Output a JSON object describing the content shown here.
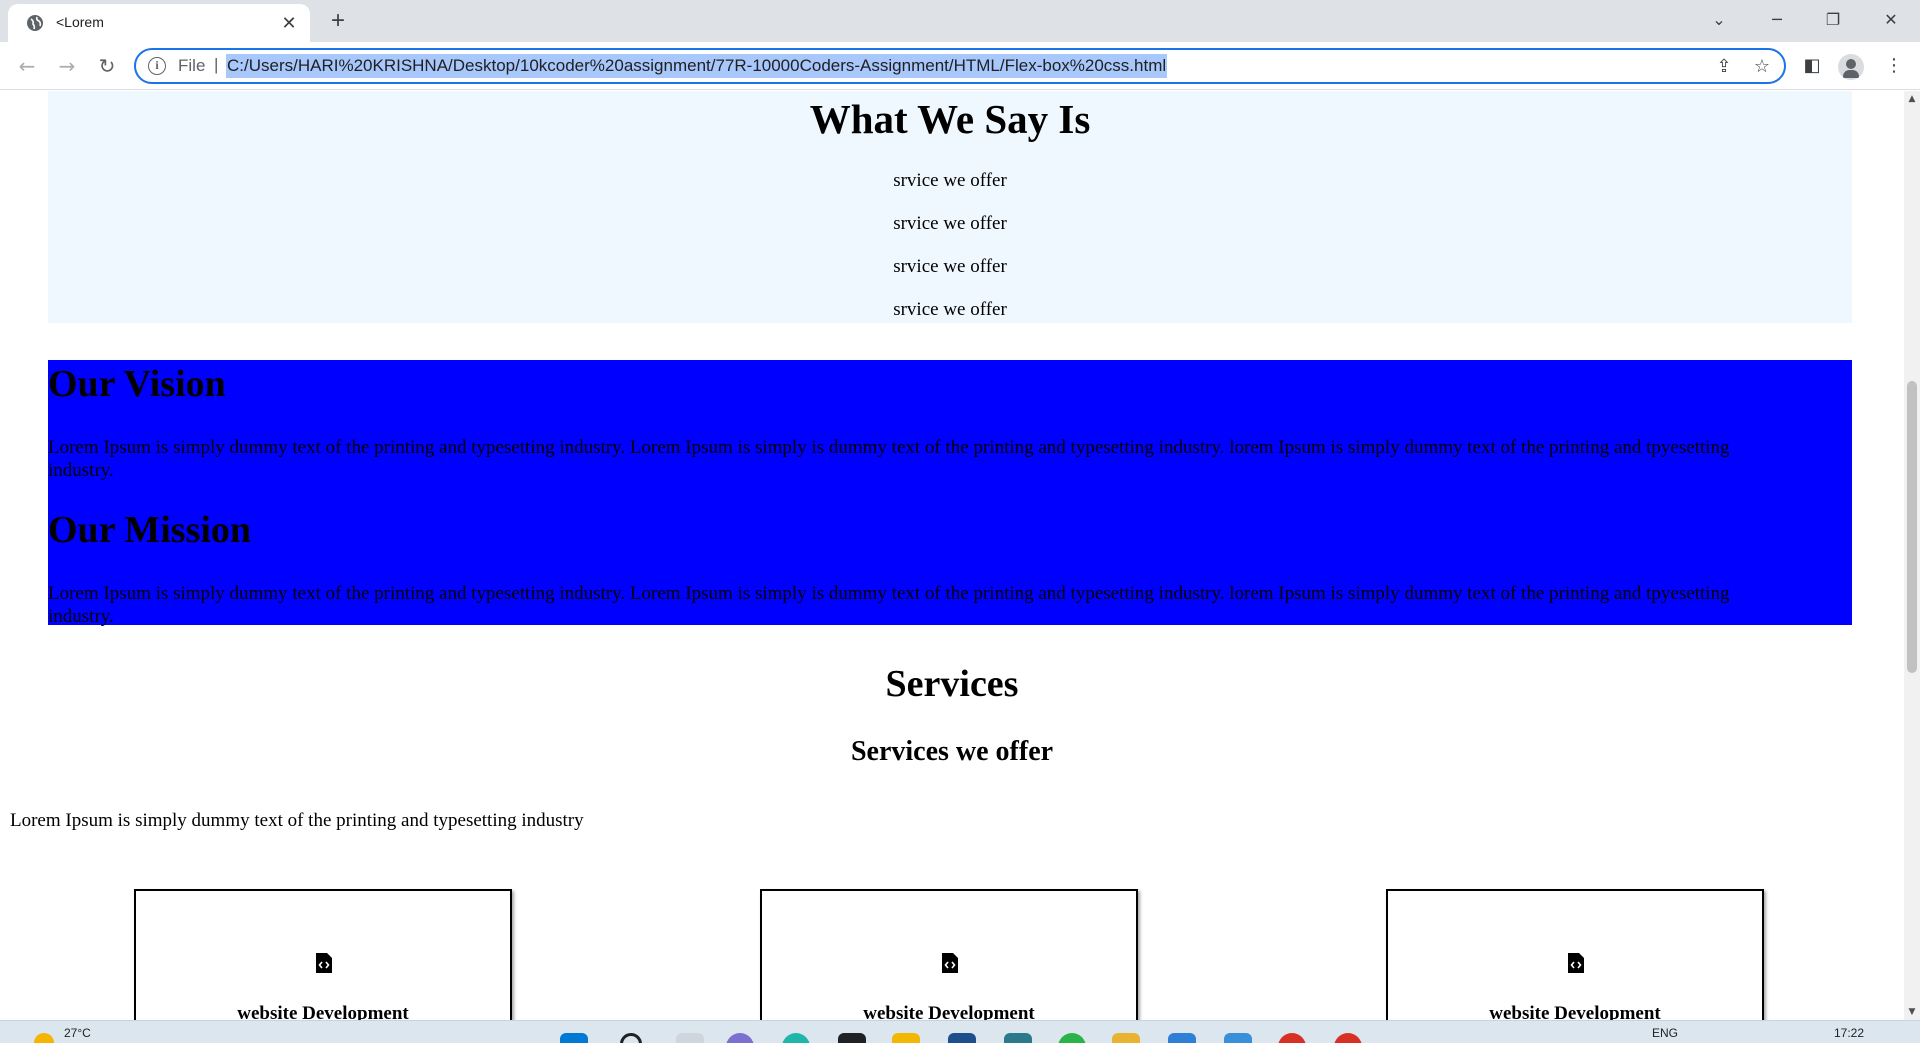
{
  "browser": {
    "tab_title": "<Lorem",
    "new_tab_symbol": "+",
    "url_scheme": "File",
    "url": "C:/Users/HARI%20KRISHNA/Desktop/10kcoder%20assignment/77R-10000Coders-Assignment/HTML/Flex-box%20css.html"
  },
  "say_section": {
    "title": "What We Say Is",
    "items": [
      "srvice we offer",
      "srvice we offer",
      "srvice we offer",
      "srvice we offer"
    ],
    "background": "#f0f8ff"
  },
  "vision_section": {
    "background": "#0000ff",
    "vision_heading": "Our Vision",
    "vision_text": "Lorem Ipsum is simply dummy text of the printing and typesetting industry. Lorem Ipsum is simply is dummy text of the printing and typesetting industry. lorem Ipsum is simply dummy text of the printing and tpyesetting industry.",
    "mission_heading": "Our Mission",
    "mission_text": "Lorem Ipsum is simply dummy text of the printing and typesetting industry. Lorem Ipsum is simply is dummy text of the printing and typesetting industry. lorem Ipsum is simply dummy text of the printing and tpyesetting industry."
  },
  "services": {
    "title": "Services",
    "subtitle": "Services we offer",
    "description": "Lorem Ipsum is simply dummy text of the printing and typesetting industry",
    "cards": [
      {
        "icon": "file-code-icon",
        "title": "website Development"
      },
      {
        "icon": "file-code-icon",
        "title": "website Development"
      },
      {
        "icon": "file-code-icon",
        "title": "website Development"
      }
    ]
  },
  "taskbar": {
    "weather": "27°C",
    "language": "ENG",
    "time": "17:22"
  }
}
